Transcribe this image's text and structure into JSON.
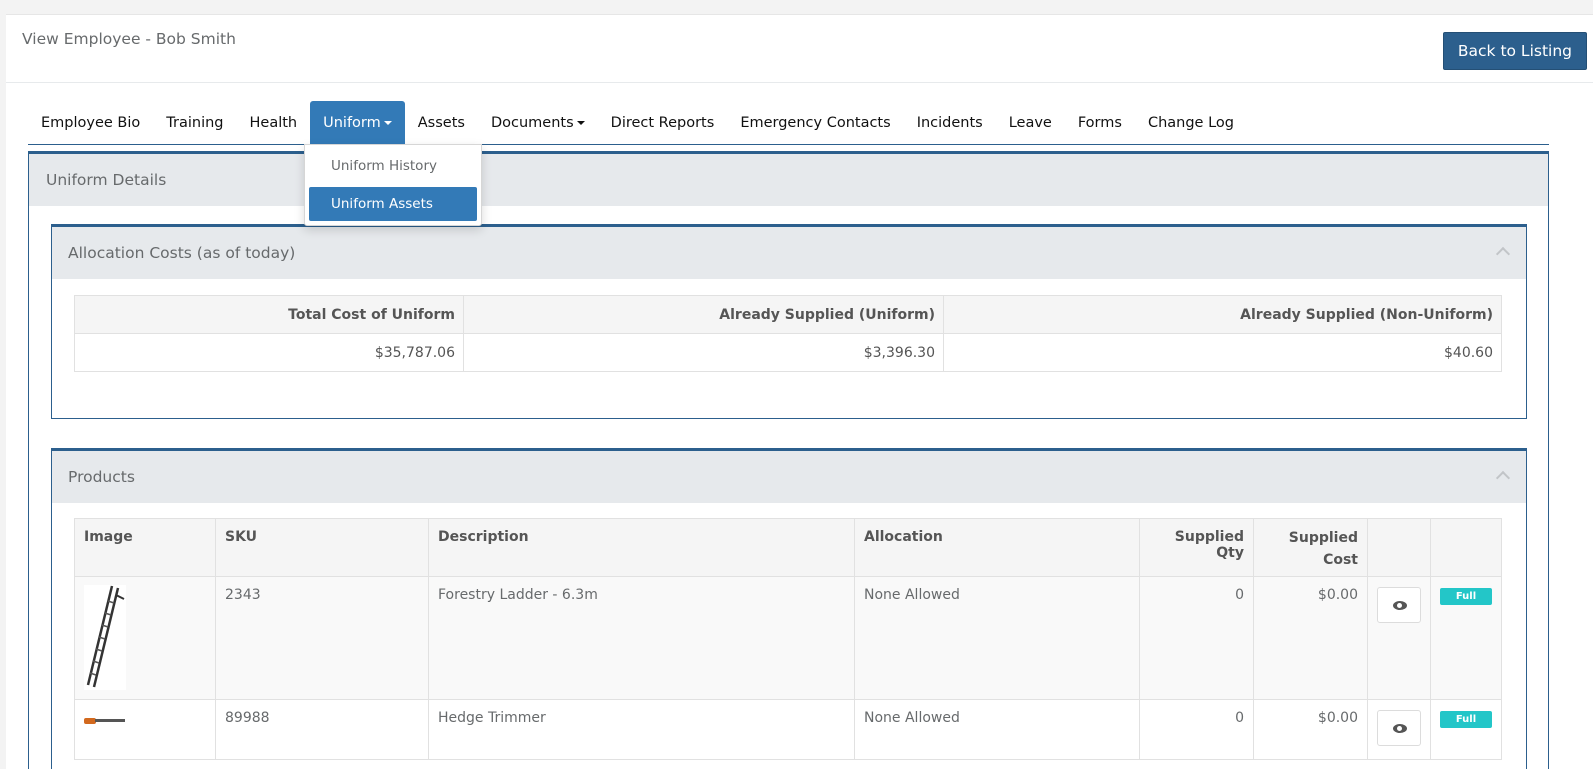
{
  "page": {
    "title": "View Employee - Bob Smith",
    "back_button": "Back to Listing"
  },
  "tabs": [
    {
      "label": "Employee Bio"
    },
    {
      "label": "Training"
    },
    {
      "label": "Health"
    },
    {
      "label": "Uniform",
      "active": true
    },
    {
      "label": "Assets"
    },
    {
      "label": "Documents"
    },
    {
      "label": "Direct Reports"
    },
    {
      "label": "Emergency Contacts"
    },
    {
      "label": "Incidents"
    },
    {
      "label": "Leave"
    },
    {
      "label": "Forms"
    },
    {
      "label": "Change Log"
    }
  ],
  "dropdown": {
    "items": [
      "Uniform History",
      "Uniform Assets"
    ],
    "selected": "Uniform Assets"
  },
  "uniform_details": {
    "title": "Uniform Details"
  },
  "allocation": {
    "title": "Allocation Costs (as of today)",
    "headers": [
      "Total Cost of Uniform",
      "Already Supplied (Uniform)",
      "Already Supplied (Non-Uniform)"
    ],
    "values": [
      "$35,787.06",
      "$3,396.30",
      "$40.60"
    ]
  },
  "products": {
    "title": "Products",
    "headers": [
      "Image",
      "SKU",
      "Description",
      "Allocation",
      "Supplied Qty",
      "Supplied Cost"
    ],
    "rows": [
      {
        "sku": "2343",
        "description": "Forestry Ladder - 6.3m",
        "allocation": "None Allowed",
        "qty": "0",
        "cost": "$0.00",
        "badge": "Full"
      },
      {
        "sku": "89988",
        "description": "Hedge Trimmer",
        "allocation": "None Allowed",
        "qty": "0",
        "cost": "$0.00",
        "badge": "Full"
      }
    ]
  },
  "colors": {
    "primary": "#337ab7",
    "dark": "#2c5f8d",
    "badge": "#23c6c8"
  }
}
